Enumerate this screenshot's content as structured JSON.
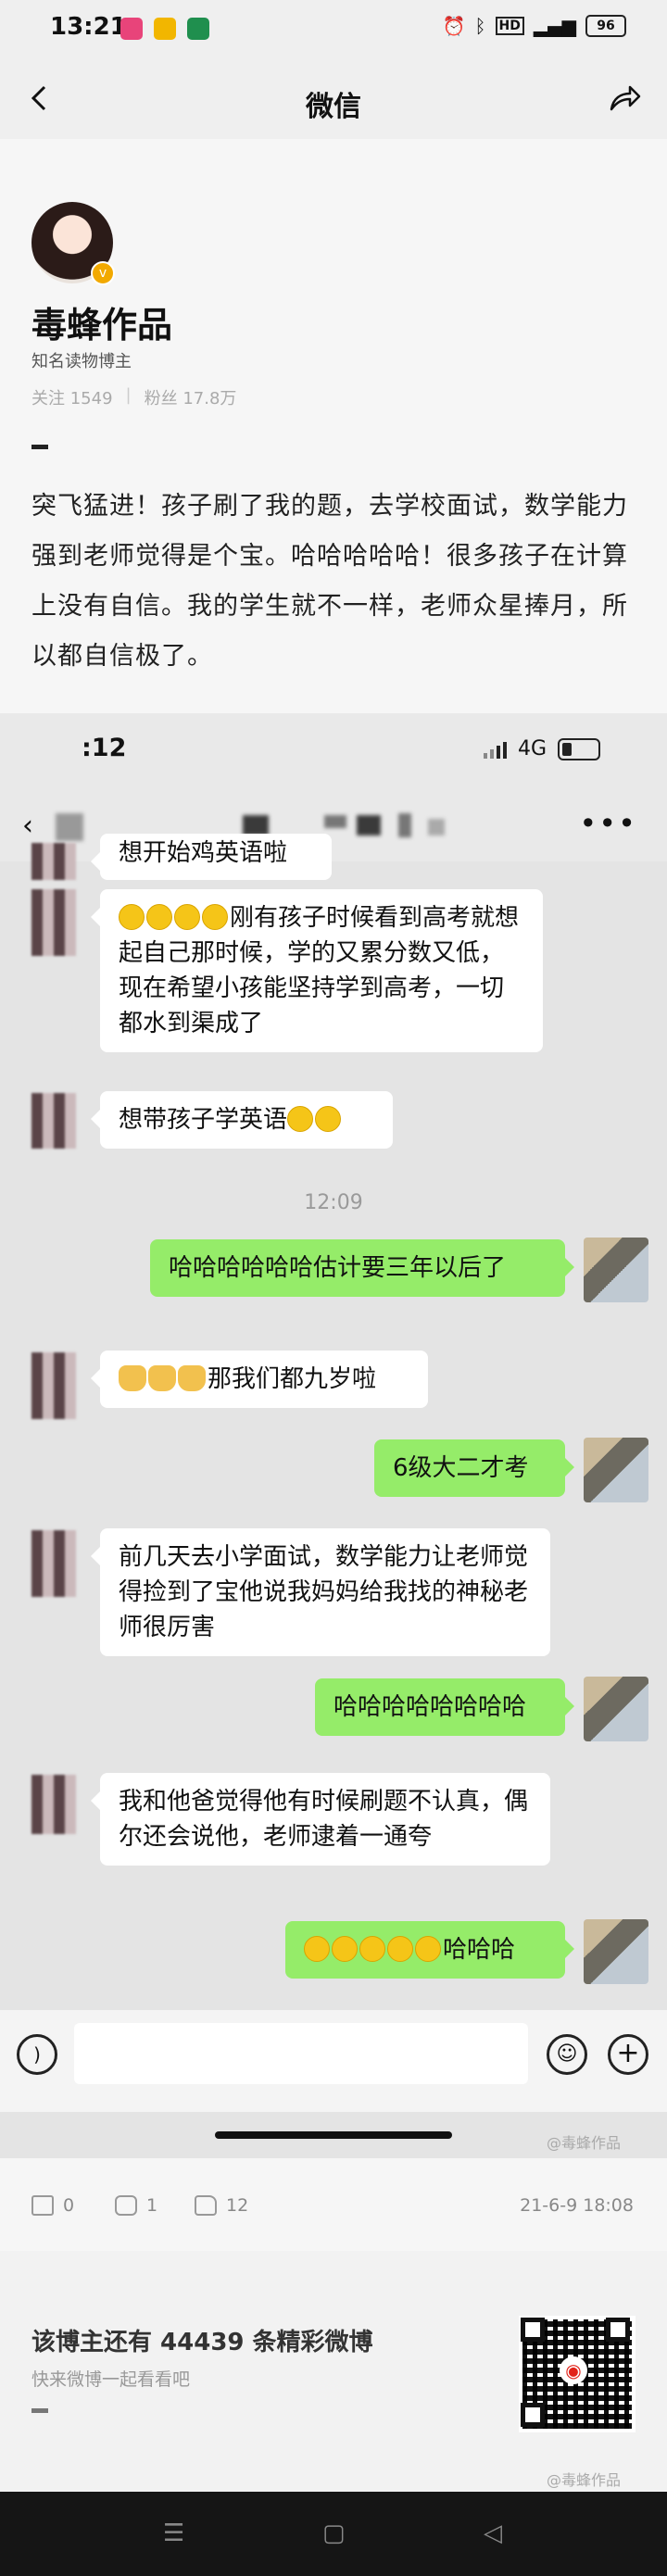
{
  "status_bar": {
    "time": "13:21",
    "battery": "96",
    "network": "HD"
  },
  "nav": {
    "title": "微信"
  },
  "post": {
    "author": "毒蜂作品",
    "author_desc": "知名读物博主",
    "following": "关注 1549",
    "followers": "粉丝 17.8万",
    "text": "突飞猛进！孩子刷了我的题，去学校面试，数学能力强到老师觉得是个宝。哈哈哈哈哈！很多孩子在计算上没有自信。我的学生就不一样，老师众星捧月，所以都自信极了。"
  },
  "screenshot": {
    "time": ":12",
    "net": "4G",
    "partial_message": "想开始鸡英语啦",
    "messages": [
      {
        "side": "left",
        "text": "刚有孩子时候看到高考就想起自己那时候，学的又累分数又低，现在希望小孩能坚持学到高考，一切都水到渠成了"
      },
      {
        "side": "left",
        "text": "想带孩子学英语"
      },
      {
        "type": "time",
        "text": "12:09"
      },
      {
        "side": "right",
        "text": "哈哈哈哈哈哈估计要三年以后了"
      },
      {
        "side": "left",
        "text": "那我们都九岁啦"
      },
      {
        "side": "right",
        "text": "6级大二才考"
      },
      {
        "side": "left",
        "text": "前几天去小学面试，数学能力让老师觉得捡到了宝他说我妈妈给我找的神秘老师很厉害"
      },
      {
        "side": "right",
        "text": "哈哈哈哈哈哈哈哈"
      },
      {
        "side": "left",
        "text": "我和他爸觉得他有时候刷题不认真，偶尔还会说他，老师逮着一通夸"
      },
      {
        "side": "right",
        "text": "哈哈哈"
      }
    ]
  },
  "actions": {
    "repost": "0",
    "comment": "1",
    "like": "12",
    "date": "21-6-9 18:08"
  },
  "watermark": "@毒蜂作品",
  "footer": {
    "title": "该博主还有 44439 条精彩微博",
    "subtitle": "快来微博一起看看吧"
  }
}
